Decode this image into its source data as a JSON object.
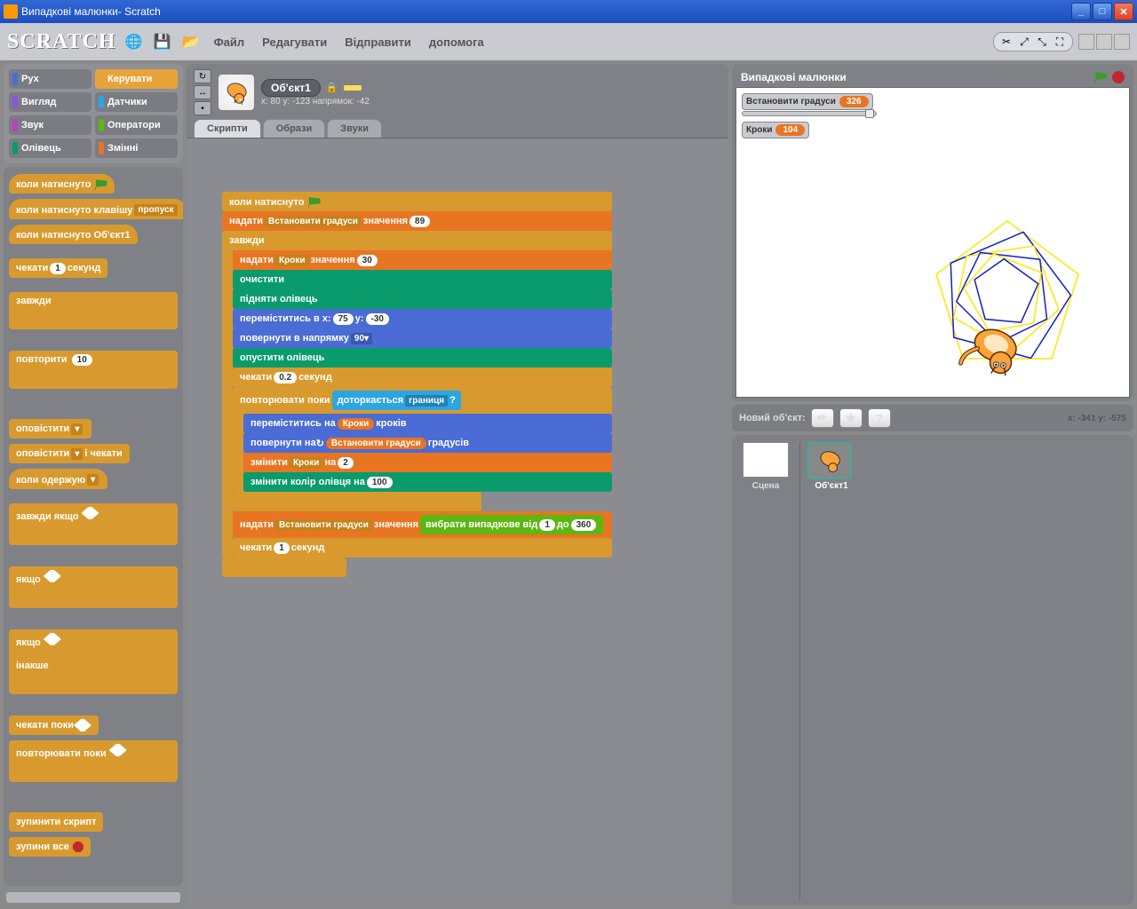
{
  "window": {
    "title": "Випадкові малюнки- Scratch"
  },
  "toolbar": {
    "logo": "SCRATCH",
    "menus": {
      "file": "Файл",
      "edit": "Редагувати",
      "send": "Відправити",
      "help": "допомога"
    }
  },
  "categories": {
    "motion": "Рух",
    "control": "Керувати",
    "looks": "Вигляд",
    "sensing": "Датчики",
    "sound": "Звук",
    "operators": "Оператори",
    "pen": "Олівець",
    "variables": "Змінні"
  },
  "palette": {
    "whenFlag": "коли натиснуто",
    "whenKey": {
      "label": "коли натиснуто клавішу",
      "arg": "пропуск"
    },
    "whenSprite": "коли натиснуто  Об'єкт1",
    "wait1": {
      "label1": "чекати",
      "arg": "1",
      "label2": "секунд"
    },
    "forever": "завжди",
    "repeat": {
      "label": "повторити",
      "arg": "10"
    },
    "broadcast": "оповістити",
    "broadcastWait": {
      "label1": "оповістити",
      "label2": "і чекати"
    },
    "whenReceive": "коли одержую",
    "foreverIf": "завжди якщо",
    "if": "якщо",
    "ifelse": {
      "if": "якщо",
      "else": "інакше"
    },
    "waitUntil": "чекати поки",
    "repeatUntil": "повторювати поки",
    "stopScript": "зупинити скрипт",
    "stopAll": "зупини все"
  },
  "sprite": {
    "name": "Об'єкт1",
    "coords": "x: 80    y: -123 напрямок: -42"
  },
  "tabs": {
    "scripts": "Скрипти",
    "costumes": "Образи",
    "sounds": "Звуки"
  },
  "script": {
    "whenFlag": "коли натиснуто",
    "setDegrees": {
      "cmd": "надати",
      "var": "Встановити  градуси",
      "lbl": "значення",
      "val": "89"
    },
    "forever": "завжди",
    "setSteps": {
      "cmd": "надати",
      "var": "Кроки",
      "lbl": "значення",
      "val": "30"
    },
    "clear": "очистити",
    "penUp": "підняти олівець",
    "goto": {
      "cmd": "переміститись в x:",
      "x": "75",
      "ylbl": "y:",
      "y": "-30"
    },
    "point": {
      "cmd": "повернути в напрямку",
      "val": "90"
    },
    "penDown": "опустити олівець",
    "wait02": {
      "cmd": "чекати",
      "val": "0.2",
      "lbl": "секунд"
    },
    "repeatUntil": "повторювати поки",
    "touching": {
      "cmd": "доторкається",
      "arg": "границя",
      "q": "?"
    },
    "move": {
      "cmd": "переміститись на",
      "var": "Кроки",
      "lbl": "кроків"
    },
    "turn": {
      "cmd": "повернути на",
      "var": "Встановити  градуси",
      "lbl": "градусів"
    },
    "changeSteps": {
      "cmd": "змінити",
      "var": "Кроки",
      "lbl": "на",
      "val": "2"
    },
    "changePen": {
      "cmd": "змінити колір олівця на",
      "val": "100"
    },
    "setDegRand": {
      "cmd": "надати",
      "var": "Встановити  градуси",
      "lbl": "значення",
      "op": "вибрати випадкове від",
      "v1": "1",
      "to": "до",
      "v2": "360"
    },
    "wait1": {
      "cmd": "чекати",
      "val": "1",
      "lbl": "секунд"
    }
  },
  "stage": {
    "title": "Випадкові малюнки",
    "monitor1": {
      "label": "Встановити градуси",
      "value": "326"
    },
    "monitor2": {
      "label": "Кроки",
      "value": "104"
    },
    "mouseCoords": "x: -341   y: -575"
  },
  "newObject": {
    "label": "Новий об'єкт:"
  },
  "scene": {
    "label": "Сцена"
  },
  "spriteList": {
    "name": "Об'єкт1"
  }
}
